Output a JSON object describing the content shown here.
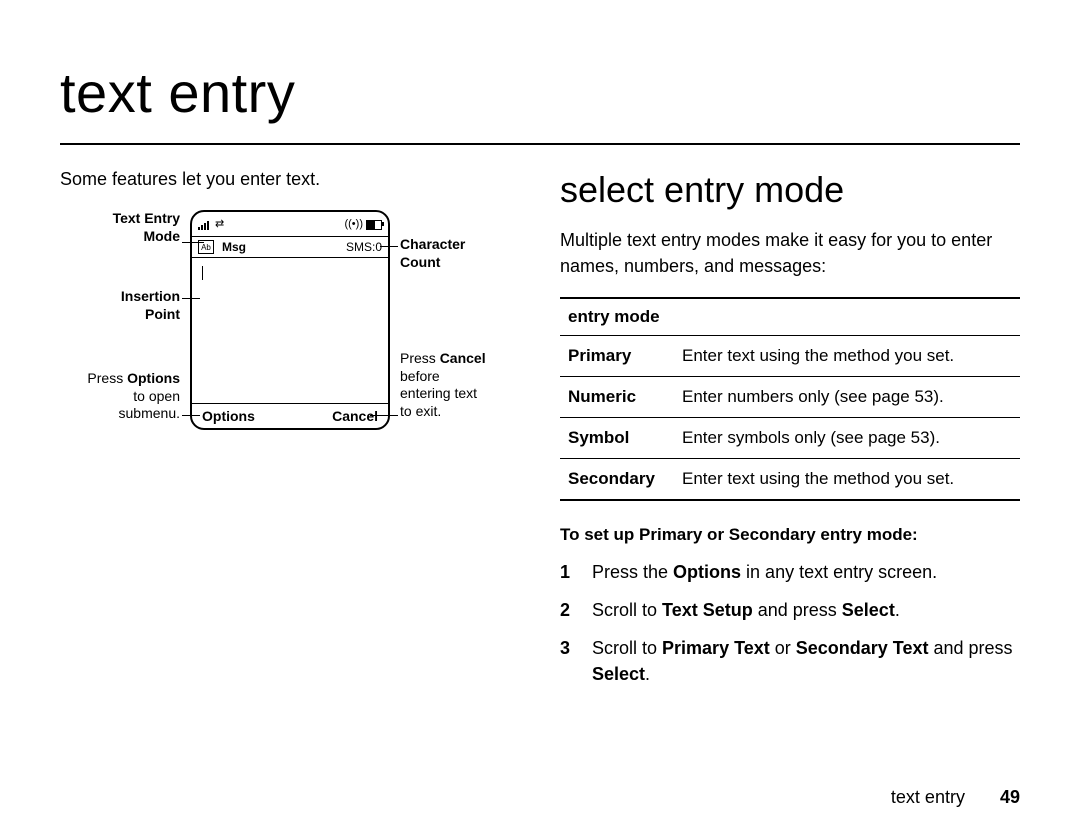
{
  "page": {
    "title": "text entry",
    "footer_section": "text entry",
    "page_number": "49"
  },
  "left": {
    "intro": "Some features let you enter text.",
    "callouts": {
      "text_entry_mode_l1": "Text Entry",
      "text_entry_mode_l2": "Mode",
      "insertion_l1": "Insertion",
      "insertion_l2": "Point",
      "press_options_l1_prefix": "Press ",
      "press_options_l1_bold": "Options",
      "press_options_l2": "to open",
      "press_options_l3": "submenu.",
      "char_count_l1": "Character",
      "char_count_l2": "Count",
      "press_cancel_l1_prefix": "Press ",
      "press_cancel_l1_bold": "Cancel",
      "press_cancel_l2": "before",
      "press_cancel_l3": "entering text",
      "press_cancel_l4": "to exit."
    },
    "phone": {
      "msg_label": "Msg",
      "sms_label": "SMS:0",
      "softkey_left": "Options",
      "softkey_right": "Cancel",
      "mode_icon_text": "Ab"
    }
  },
  "right": {
    "heading": "select entry mode",
    "para": "Multiple text entry modes make it easy for you to enter names, numbers, and messages:",
    "table_header": "entry mode",
    "rows": [
      {
        "mode": "Primary",
        "desc": "Enter text using the method you set."
      },
      {
        "mode": "Numeric",
        "desc": "Enter numbers only (see page 53)."
      },
      {
        "mode": "Symbol",
        "desc": "Enter symbols only (see page 53)."
      },
      {
        "mode": "Secondary",
        "desc": "Enter text using the method you set."
      }
    ],
    "subhead": "To set up Primary or Secondary entry mode:",
    "steps": [
      {
        "n": "1",
        "pre": "Press the ",
        "b1": "Options",
        "post": " in any text entry screen."
      },
      {
        "n": "2",
        "pre": "Scroll to ",
        "b1": "Text Setup",
        "mid": " and press ",
        "b2": "Select",
        "post": "."
      },
      {
        "n": "3",
        "pre": "Scroll to ",
        "b1": "Primary Text",
        "mid": " or ",
        "b2": "Secondary Text",
        "mid2": " and press ",
        "b3": "Select",
        "post": "."
      }
    ]
  }
}
